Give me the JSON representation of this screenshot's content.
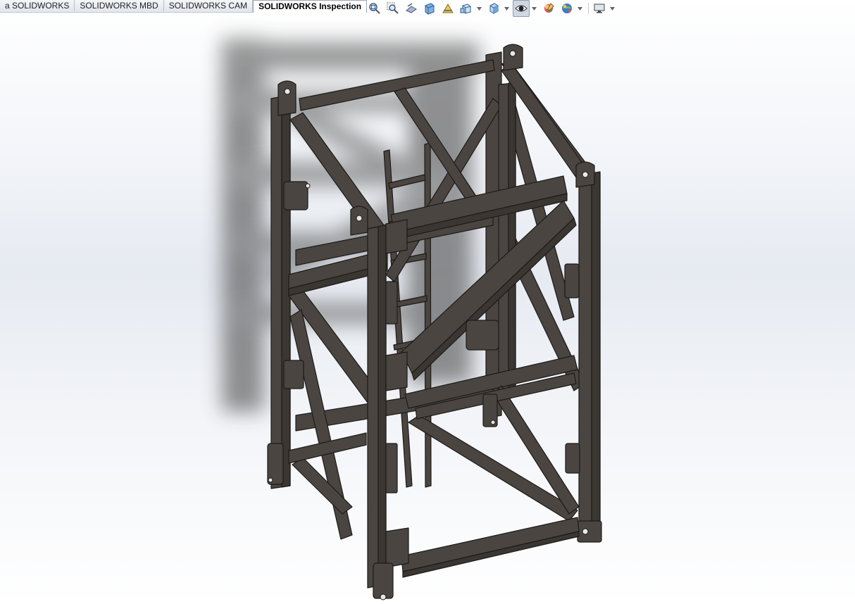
{
  "tabs": [
    {
      "label": "a SOLIDWORKS",
      "active": false
    },
    {
      "label": "SOLIDWORKS MBD",
      "active": false
    },
    {
      "label": "SOLIDWORKS CAM",
      "active": false
    },
    {
      "label": "SOLIDWORKS Inspection",
      "active": true
    }
  ],
  "toolbar": {
    "buttons": [
      {
        "name": "zoom-to-fit-icon"
      },
      {
        "name": "zoom-to-area-icon"
      },
      {
        "name": "previous-view-icon"
      },
      {
        "name": "section-view-icon"
      },
      {
        "name": "dynamic-annotation-icon"
      },
      {
        "name": "view-orientation-icon",
        "dropdown": true
      },
      {
        "name": "display-style-icon",
        "dropdown": true
      },
      {
        "name": "hide-show-items-icon",
        "dropdown": true,
        "active": true
      },
      {
        "name": "edit-appearance-icon"
      },
      {
        "name": "apply-scene-icon",
        "dropdown": true
      },
      {
        "name": "view-settings-icon",
        "dropdown": true
      }
    ]
  },
  "viewport": {
    "background_top": "#ffffff",
    "background_mid": "#e6eaf1",
    "model_color": "#4a4540",
    "edge_color": "#1c1a18"
  }
}
